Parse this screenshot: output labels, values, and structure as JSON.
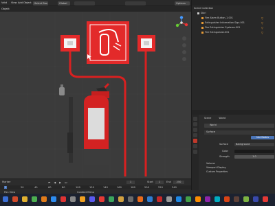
{
  "topbar": {
    "menus": [
      "Vstd",
      "View",
      "Add",
      "Object"
    ],
    "mode": "Objekt",
    "shading_select": "Select Box",
    "transform": "Global",
    "options": "Options"
  },
  "outliner": {
    "title": "Scene Collection",
    "collection": "Sbirl",
    "items": [
      {
        "label": "Fire Alarm Button_1.001"
      },
      {
        "label": "Extinguisher Information Sign.001"
      },
      {
        "label": "Fire Extinguisher Systems.001"
      },
      {
        "label": "Fire Extinguisher.001"
      }
    ]
  },
  "properties": {
    "scene_label": "Scene",
    "world_label": "World",
    "world_name": "World",
    "surface_header": "Surface",
    "use_nodes": "Use Nodes",
    "surface_label": "Surface",
    "surface_value": "Background",
    "color_label": "Color",
    "strength_label": "Strength",
    "strength_value": "1.0",
    "volume_header": "Volume",
    "viewport_display": "Viewport Display",
    "custom_props": "Custom Properties"
  },
  "timeline": {
    "menu": "Marker",
    "frame_current": "1",
    "start_label": "Start",
    "start_value": "1",
    "end_label": "End",
    "end_value": "250",
    "ticks": [
      "20",
      "40",
      "60",
      "80",
      "100",
      "120",
      "140",
      "160",
      "180",
      "200",
      "220",
      "240"
    ]
  },
  "status": {
    "left": "Pan View",
    "middle": "Context Menu"
  },
  "colors": {
    "sign_red": "#e32a2a",
    "accent_orange": "#e59a36",
    "selection_blue": "#4b75b8",
    "taskbar": "#1c2230"
  }
}
